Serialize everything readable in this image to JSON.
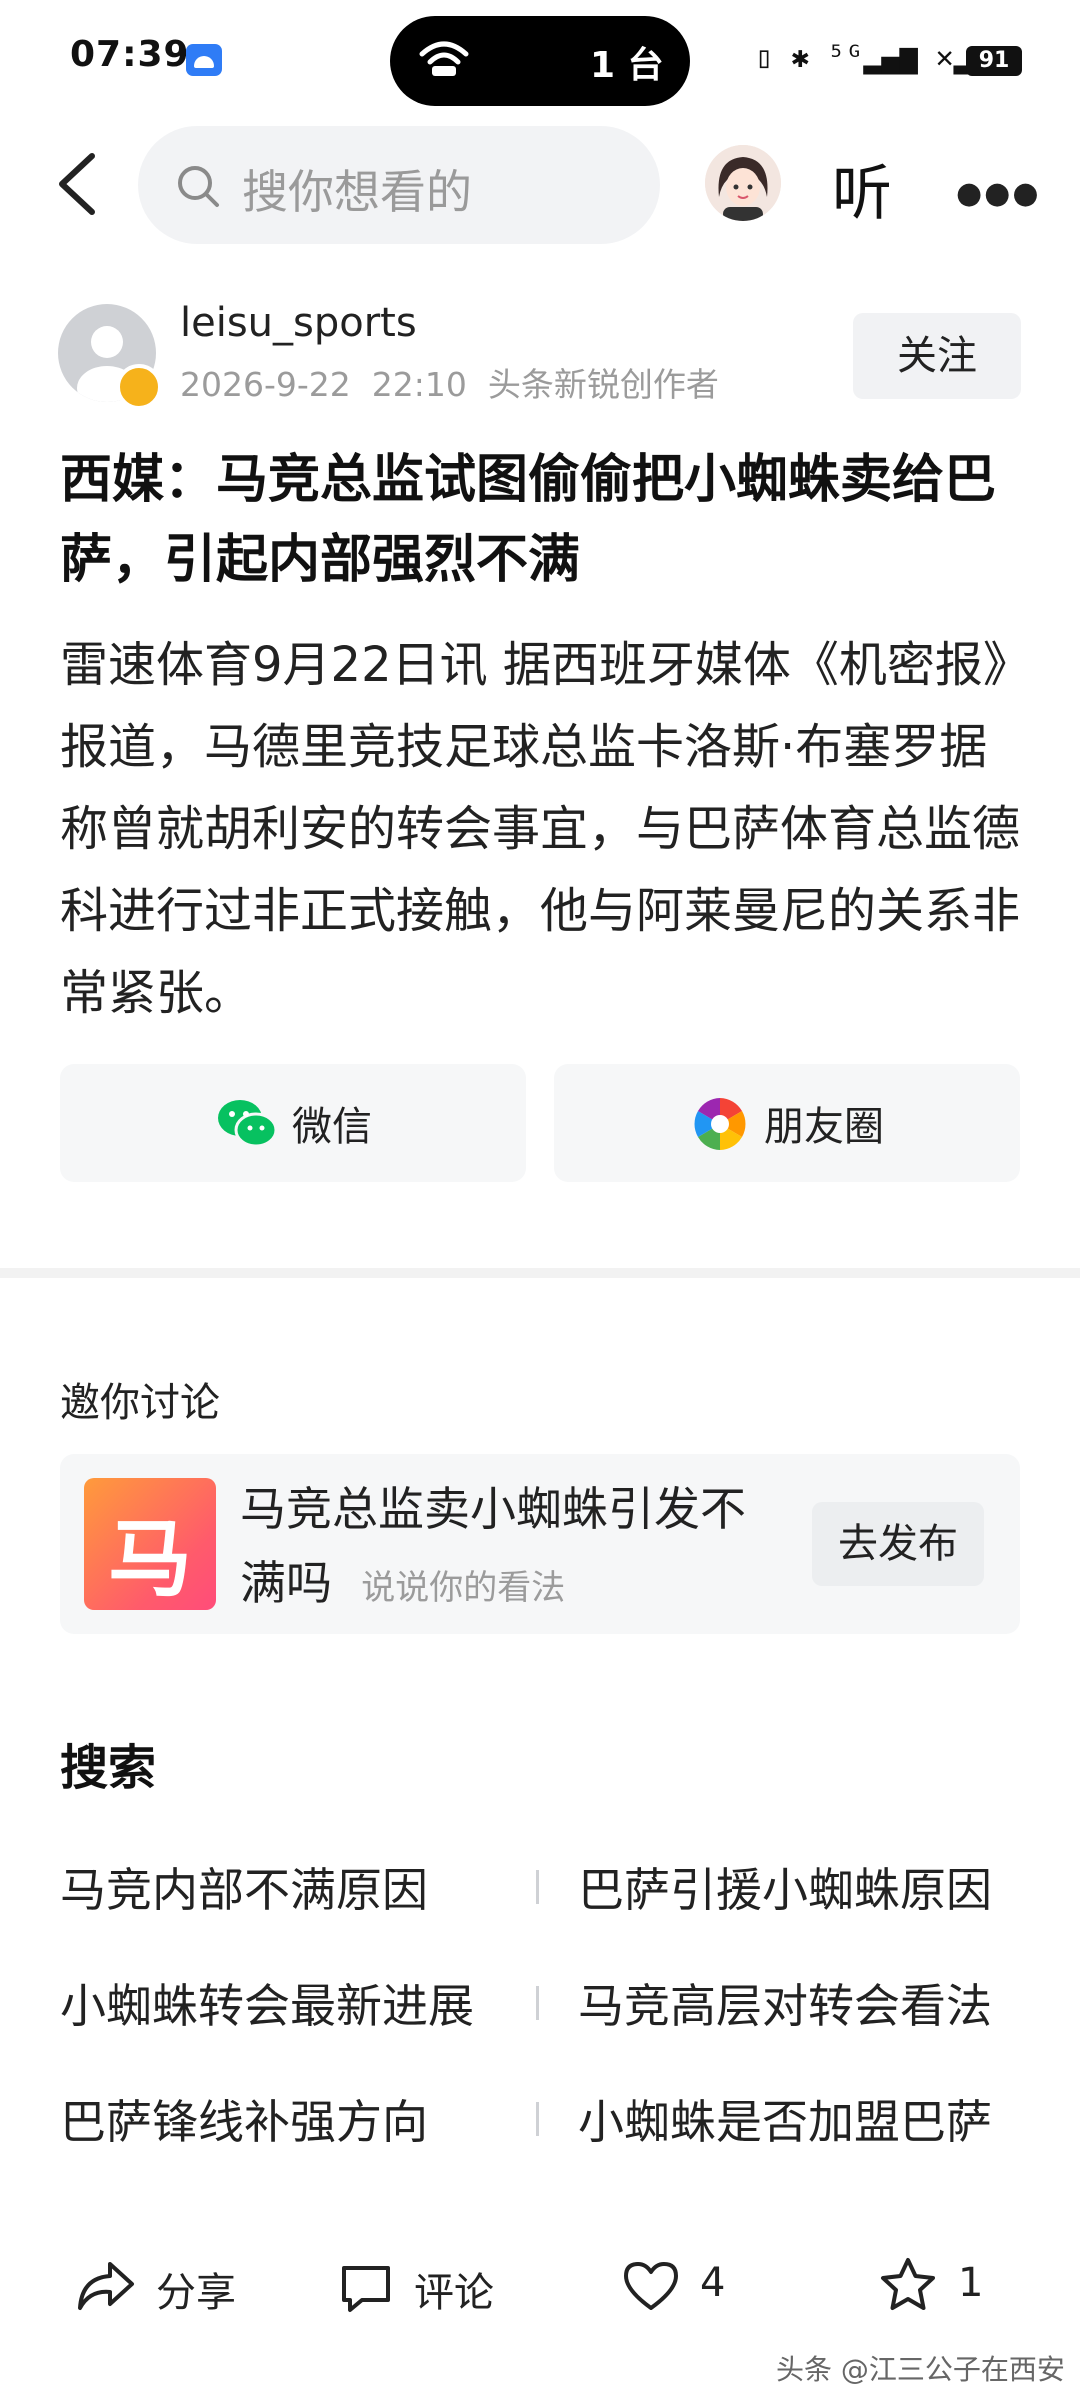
{
  "status_bar": {
    "time": "07:39",
    "pill_text": "1 台",
    "sys_icons": "▯ ✱ ⁵ᴳ▂▄▆ ✕▂▄▆",
    "battery": "91"
  },
  "nav": {
    "search_placeholder": "搜你想看的",
    "listen_label": "听",
    "more_label": "●●●"
  },
  "author": {
    "name": "leisu_sports",
    "date": "2026-9-22",
    "time": "22:10",
    "tag": "头条新锐创作者",
    "follow_label": "关注"
  },
  "article": {
    "title": "西媒：马竞总监试图偷偷把小蜘蛛卖给巴萨，引起内部强烈不满",
    "body": "雷速体育9月22日讯 据西班牙媒体《机密报》报道，马德里竞技足球总监卡洛斯·布塞罗据称曾就胡利安的转会事宜，与巴萨体育总监德科进行过非正式接触，他与阿莱曼尼的关系非常紧张。"
  },
  "share": {
    "wechat_label": "微信",
    "moments_label": "朋友圈"
  },
  "discussion": {
    "section_title": "邀你讨论",
    "topic_icon_char": "马",
    "topic_title": "马竞总监卖小蜘蛛引发不满吗",
    "topic_hint": "说说你的看法",
    "post_label": "去发布"
  },
  "search": {
    "section_title": "搜索",
    "suggestions": [
      "马竞内部不满原因",
      "巴萨引援小蜘蛛原因",
      "小蜘蛛转会最新进展",
      "马竞高层对转会看法",
      "巴萨锋线补强方向",
      "小蜘蛛是否加盟巴萨"
    ]
  },
  "bottom_bar": {
    "share_label": "分享",
    "comment_label": "评论",
    "like_count": "4",
    "favorite_count": "1"
  },
  "watermark": "头条 @江三公子在西安",
  "colors": {
    "search_bg": "#f2f3f5",
    "card_bg": "#f6f7f8",
    "wechat_green": "#07c160",
    "badge_orange": "#f6b21b"
  }
}
